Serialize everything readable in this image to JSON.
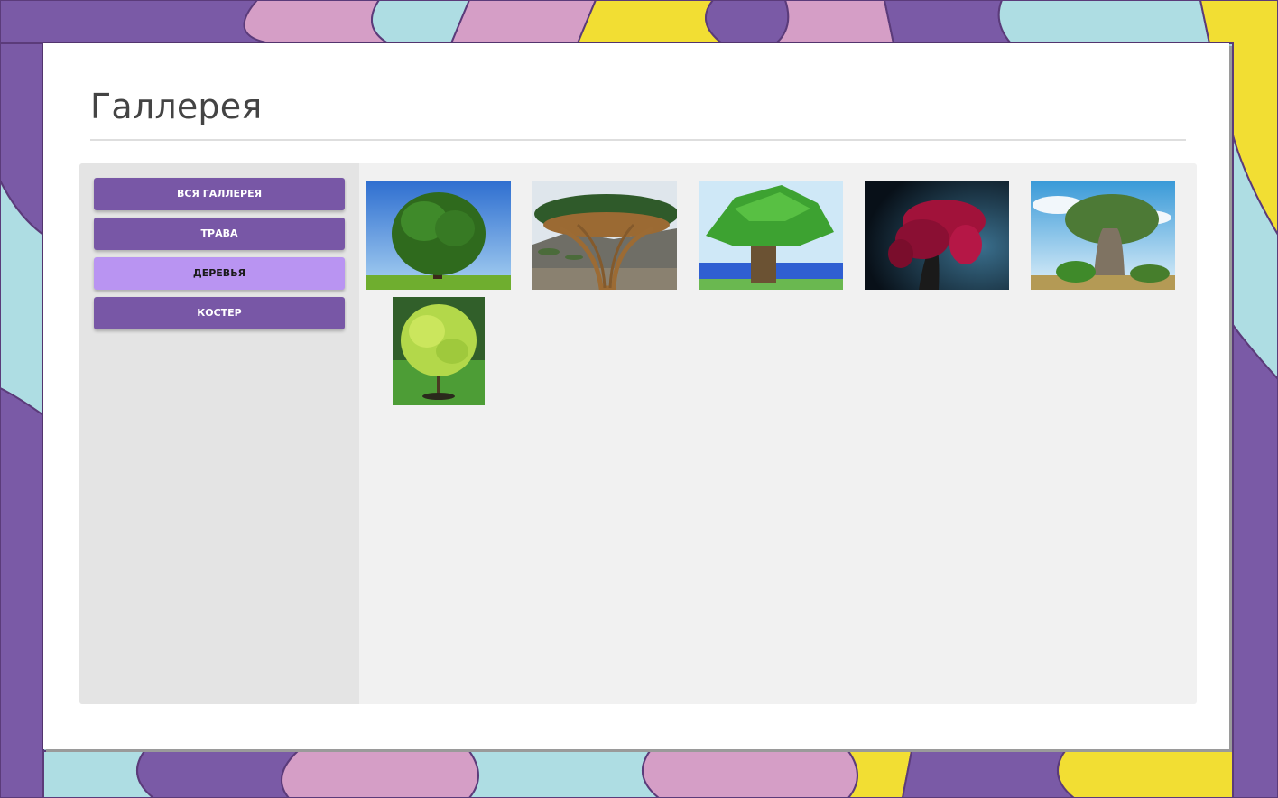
{
  "page": {
    "title": "Галлерея"
  },
  "sidebar": {
    "items": [
      {
        "label": "ВСЯ ГАЛЛЕРЕЯ",
        "active": false
      },
      {
        "label": "ТРАВА",
        "active": false
      },
      {
        "label": "ДЕРЕВЬЯ",
        "active": true
      },
      {
        "label": "КОСТЕР",
        "active": false
      }
    ]
  },
  "gallery": {
    "images": [
      {
        "subject": "tree in meadow"
      },
      {
        "subject": "dragon blood tree"
      },
      {
        "subject": "blocky tree"
      },
      {
        "subject": "red flowering tree at night"
      },
      {
        "subject": "baobab tree"
      },
      {
        "subject": "yellow-green bush"
      }
    ]
  },
  "colors": {
    "accent": "#7857a6",
    "active": "#b994f2",
    "background_purple": "#7a5aa6",
    "background_pink": "#d59ec6",
    "background_yellow": "#f2de33",
    "background_blue": "#aedde3"
  }
}
